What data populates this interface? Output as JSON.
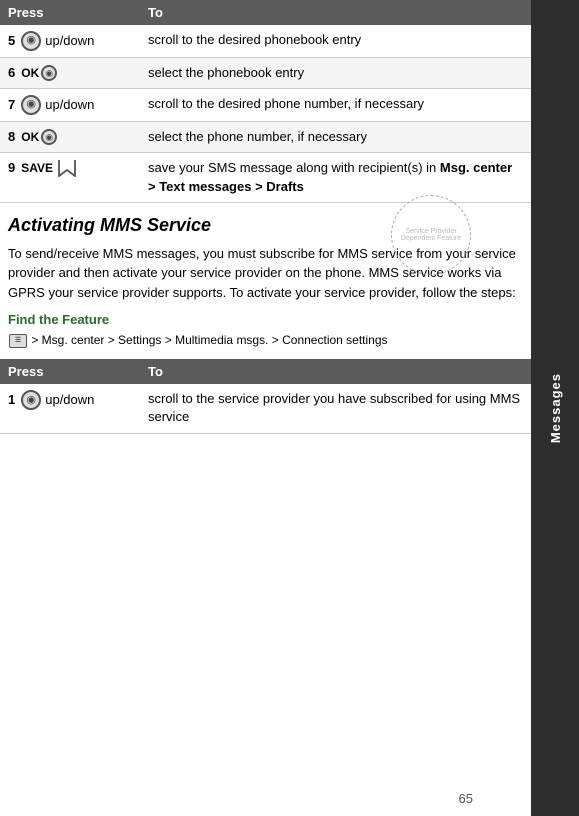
{
  "sidebar": {
    "label": "Messages"
  },
  "table1": {
    "headers": [
      "Press",
      "To"
    ],
    "rows": [
      {
        "num": "5",
        "press_type": "nav",
        "press_label": "up/down",
        "to_text": "scroll to the desired phonebook entry"
      },
      {
        "num": "6",
        "press_type": "ok",
        "press_label": "OK",
        "to_text": "select the phonebook entry"
      },
      {
        "num": "7",
        "press_type": "nav",
        "press_label": "up/down",
        "to_text": "scroll to the desired phone number, if necessary"
      },
      {
        "num": "8",
        "press_type": "ok",
        "press_label": "OK",
        "to_text": "select the phone number, if necessary"
      },
      {
        "num": "9",
        "press_type": "save",
        "press_label": "SAVE",
        "to_text_plain": "save your SMS message along with recipient(s) in ",
        "to_text_bold": "Msg. center > Text messages > Drafts"
      }
    ]
  },
  "section": {
    "title": "Activating MMS Service",
    "body": "To send/receive MMS messages, you must subscribe for MMS service from your service provider and then activate your service provider on the phone. MMS service works via GPRS your service provider supports. To activate your service provider, follow the steps:"
  },
  "find_feature": {
    "label": "Find the Feature",
    "path_before": "MENU",
    "path_after": "> Msg. center > Settings > Multimedia msgs. > Connection settings"
  },
  "table2": {
    "headers": [
      "Press",
      "To"
    ],
    "rows": [
      {
        "num": "1",
        "press_type": "nav",
        "press_label": "up/down",
        "to_text": "scroll to the service provider you have subscribed for using MMS service"
      }
    ]
  },
  "page_number": "65",
  "watermark_text": "Service Provider Dependent Feature"
}
